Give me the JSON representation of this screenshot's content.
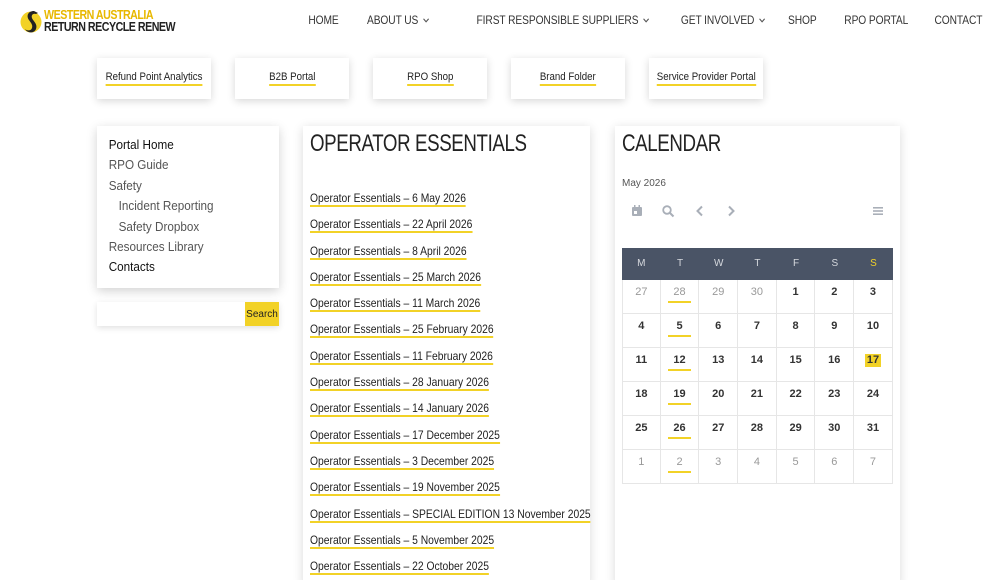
{
  "brand": {
    "line1": "WESTERN AUSTRALIA",
    "line2": "RETURN RECYCLE RENEW",
    "accent": "#f2d227"
  },
  "nav": [
    {
      "label": "HOME",
      "dropdown": false
    },
    {
      "label": "ABOUT US",
      "dropdown": true
    },
    {
      "label": "FIRST RESPONSIBLE SUPPLIERS",
      "dropdown": true
    },
    {
      "label": "GET INVOLVED",
      "dropdown": true
    },
    {
      "label": "SHOP",
      "dropdown": false
    },
    {
      "label": "RPO PORTAL",
      "dropdown": false
    },
    {
      "label": "CONTACT",
      "dropdown": false
    }
  ],
  "quicklinks": [
    "Refund Point Analytics",
    "B2B Portal",
    "RPO Shop",
    "Brand Folder",
    "Service Provider Portal"
  ],
  "sidemenu": [
    {
      "label": "Portal Home",
      "active": true,
      "sub": false
    },
    {
      "label": "RPO Guide",
      "active": false,
      "sub": false
    },
    {
      "label": "Safety",
      "active": false,
      "sub": false
    },
    {
      "label": "Incident Reporting",
      "active": false,
      "sub": true
    },
    {
      "label": "Safety Dropbox",
      "active": false,
      "sub": true
    },
    {
      "label": "Resources Library",
      "active": false,
      "sub": false
    },
    {
      "label": "Contacts",
      "active": true,
      "sub": false
    }
  ],
  "search": {
    "button_label": "Search",
    "value": ""
  },
  "essentials": {
    "title": "OPERATOR ESSENTIALS",
    "items": [
      "Operator Essentials – 6 May 2026",
      "Operator Essentials – 22 April 2026",
      "Operator Essentials – 8 April 2026",
      "Operator Essentials – 25 March 2026",
      "Operator Essentials – 11 March 2026",
      "Operator Essentials – 25 February 2026",
      "Operator Essentials – 11 February 2026",
      "Operator Essentials – 28 January 2026",
      "Operator Essentials – 14 January 2026",
      "Operator Essentials – 17 December 2025",
      "Operator Essentials – 3 December 2025",
      "Operator Essentials – 19 November 2025",
      "Operator Essentials – SPECIAL EDITION 13 November 2025",
      "Operator Essentials – 5 November 2025",
      "Operator Essentials – 22 October 2025"
    ]
  },
  "calendar": {
    "title": "CALENDAR",
    "month_label": "May 2026",
    "tools": [
      "calendar-icon",
      "search-icon",
      "chevron-left-icon",
      "chevron-right-icon",
      "menu-icon"
    ],
    "weekdays": [
      "M",
      "T",
      "W",
      "T",
      "F",
      "S",
      "S"
    ],
    "weeks": [
      [
        {
          "d": "27",
          "other": true
        },
        {
          "d": "28",
          "other": true,
          "event": true
        },
        {
          "d": "29",
          "other": true
        },
        {
          "d": "30",
          "other": true
        },
        {
          "d": "1"
        },
        {
          "d": "2"
        },
        {
          "d": "3"
        }
      ],
      [
        {
          "d": "4"
        },
        {
          "d": "5",
          "event": true
        },
        {
          "d": "6"
        },
        {
          "d": "7"
        },
        {
          "d": "8"
        },
        {
          "d": "9"
        },
        {
          "d": "10"
        }
      ],
      [
        {
          "d": "11"
        },
        {
          "d": "12",
          "event": true
        },
        {
          "d": "13"
        },
        {
          "d": "14"
        },
        {
          "d": "15"
        },
        {
          "d": "16"
        },
        {
          "d": "17",
          "today": true
        }
      ],
      [
        {
          "d": "18"
        },
        {
          "d": "19",
          "event": true
        },
        {
          "d": "20"
        },
        {
          "d": "21"
        },
        {
          "d": "22"
        },
        {
          "d": "23"
        },
        {
          "d": "24"
        }
      ],
      [
        {
          "d": "25"
        },
        {
          "d": "26",
          "event": true
        },
        {
          "d": "27"
        },
        {
          "d": "28"
        },
        {
          "d": "29"
        },
        {
          "d": "30"
        },
        {
          "d": "31"
        }
      ],
      [
        {
          "d": "1",
          "other": true
        },
        {
          "d": "2",
          "other": true,
          "event": true
        },
        {
          "d": "3",
          "other": true
        },
        {
          "d": "4",
          "other": true
        },
        {
          "d": "5",
          "other": true
        },
        {
          "d": "6",
          "other": true
        },
        {
          "d": "7",
          "other": true
        }
      ]
    ]
  }
}
